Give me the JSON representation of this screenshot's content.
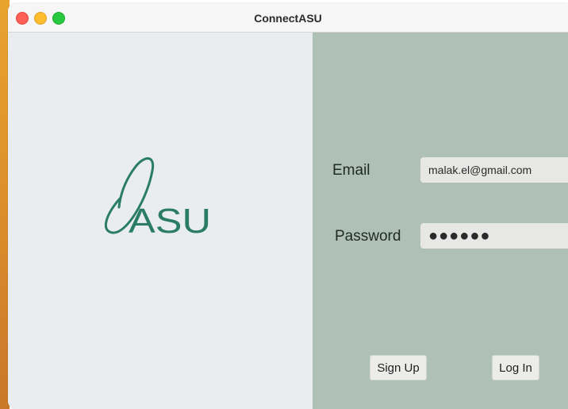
{
  "window": {
    "title": "ConnectASU"
  },
  "logo": {
    "text": "ASU",
    "color": "#2a7d62"
  },
  "form": {
    "email_label": "Email",
    "email_value": "malak.el@gmail.com",
    "password_label": "Password",
    "password_masked": "●●●●●●"
  },
  "buttons": {
    "signup_label": "Sign Up",
    "login_label": "Log In"
  },
  "colors": {
    "left_background": "#e9edf0",
    "right_background": "#afc1b6",
    "close": "#fe5f57",
    "minimize": "#febc2e",
    "maximize": "#28c840"
  }
}
